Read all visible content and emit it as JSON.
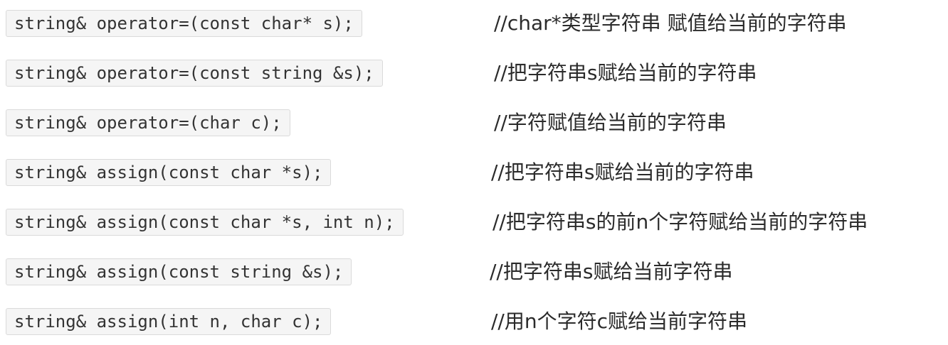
{
  "rows": [
    {
      "code": "string& operator=(const char* s);",
      "comment": "//char*类型字符串 赋值给当前的字符串"
    },
    {
      "code": "string& operator=(const string &s);",
      "comment": "//把字符串s赋给当前的字符串"
    },
    {
      "code": "string& operator=(char c);",
      "comment": "//字符赋值给当前的字符串"
    },
    {
      "code": "string& assign(const char *s);",
      "comment": "//把字符串s赋给当前的字符串"
    },
    {
      "code": "string& assign(const char *s, int n);",
      "comment": "//把字符串s的前n个字符赋给当前的字符串"
    },
    {
      "code": "string& assign(const string &s);",
      "comment": "//把字符串s赋给当前字符串"
    },
    {
      "code": "string& assign(int n, char c);",
      "comment": "//用n个字符c赋给当前字符串"
    }
  ]
}
